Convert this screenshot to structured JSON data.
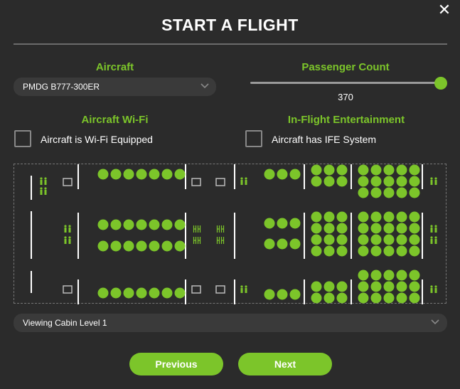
{
  "window": {
    "title": "START A FLIGHT",
    "close_icon": "close-icon"
  },
  "aircraft": {
    "label": "Aircraft",
    "selected": "PMDG B777-300ER"
  },
  "passengers": {
    "label": "Passenger Count",
    "value": "370",
    "fraction": 1.0
  },
  "wifi": {
    "label": "Aircraft Wi-Fi",
    "checkbox_label": "Aircraft is Wi-Fi Equipped",
    "checked": false
  },
  "ife": {
    "label": "In-Flight Entertainment",
    "checkbox_label": "Aircraft has IFE System",
    "checked": false
  },
  "seatmap": {
    "seat_color": "#7cc52a",
    "icons": [
      "lavatory-icon",
      "galley-icon",
      "crew-seat-icon",
      "seat-icon"
    ]
  },
  "cabin_level": {
    "selected": "Viewing Cabin Level 1"
  },
  "buttons": {
    "previous": "Previous",
    "next": "Next"
  }
}
